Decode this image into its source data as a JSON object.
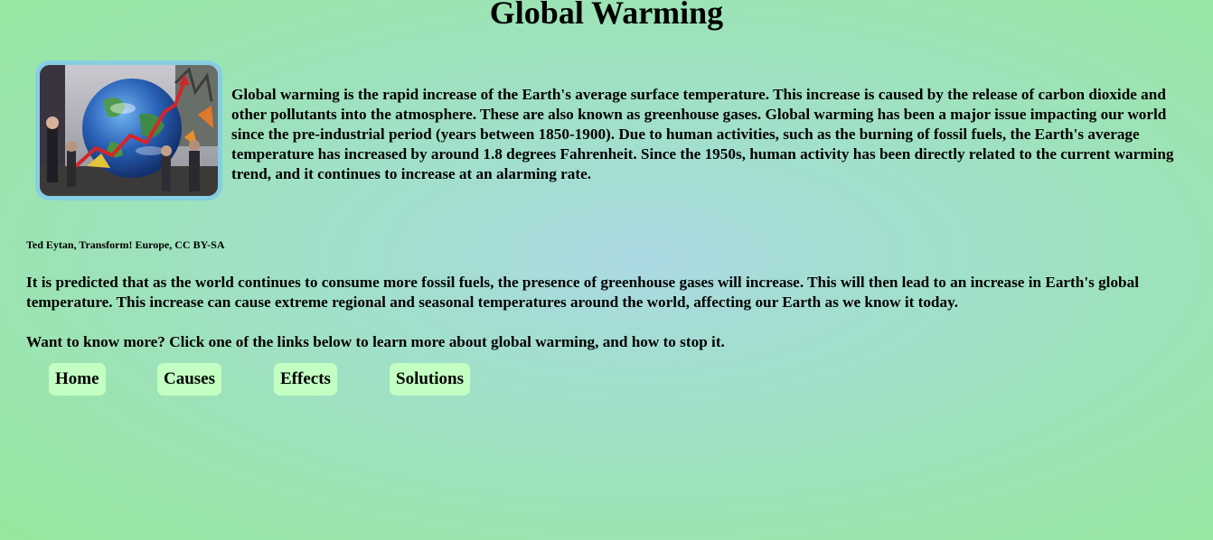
{
  "page": {
    "title": "Global Warming"
  },
  "intro": {
    "image_alt": "Protesters carrying a large inflatable Earth globe with a rising red graph line",
    "text": "Global warming is the rapid increase of the Earth's average surface temperature. This increase is caused by the release of carbon dioxide and other pollutants into the atmosphere. These are also known as greenhouse gases. Global warming has been a major issue impacting our world since the pre-industrial period (years between 1850-1900). Due to human activities, such as the burning of fossil fuels, the Earth's average temperature has increased by around 1.8 degrees Fahrenheit. Since the 1950s, human activity has been directly related to the current warming trend, and it continues to increase at an alarming rate."
  },
  "credit": "Ted Eytan, Transform! Europe, CC BY-SA",
  "prediction": "It is predicted that as the world continues to consume more fossil fuels, the presence of greenhouse gases will increase. This will then lead to an increase in Earth's global temperature. This increase can cause extreme regional and seasonal temperatures around the world, affecting our Earth as we know it today.",
  "more_prompt": "Want to know more? Click one of the links below to learn more about global warming, and how to stop it.",
  "nav": {
    "home": "Home",
    "causes": "Causes",
    "effects": "Effects",
    "solutions": "Solutions"
  },
  "colors": {
    "button_bg": "#c3ffc3",
    "image_border": "#86cfe3",
    "background_center": "#abd9e3",
    "background_edge": "#97e79d"
  }
}
